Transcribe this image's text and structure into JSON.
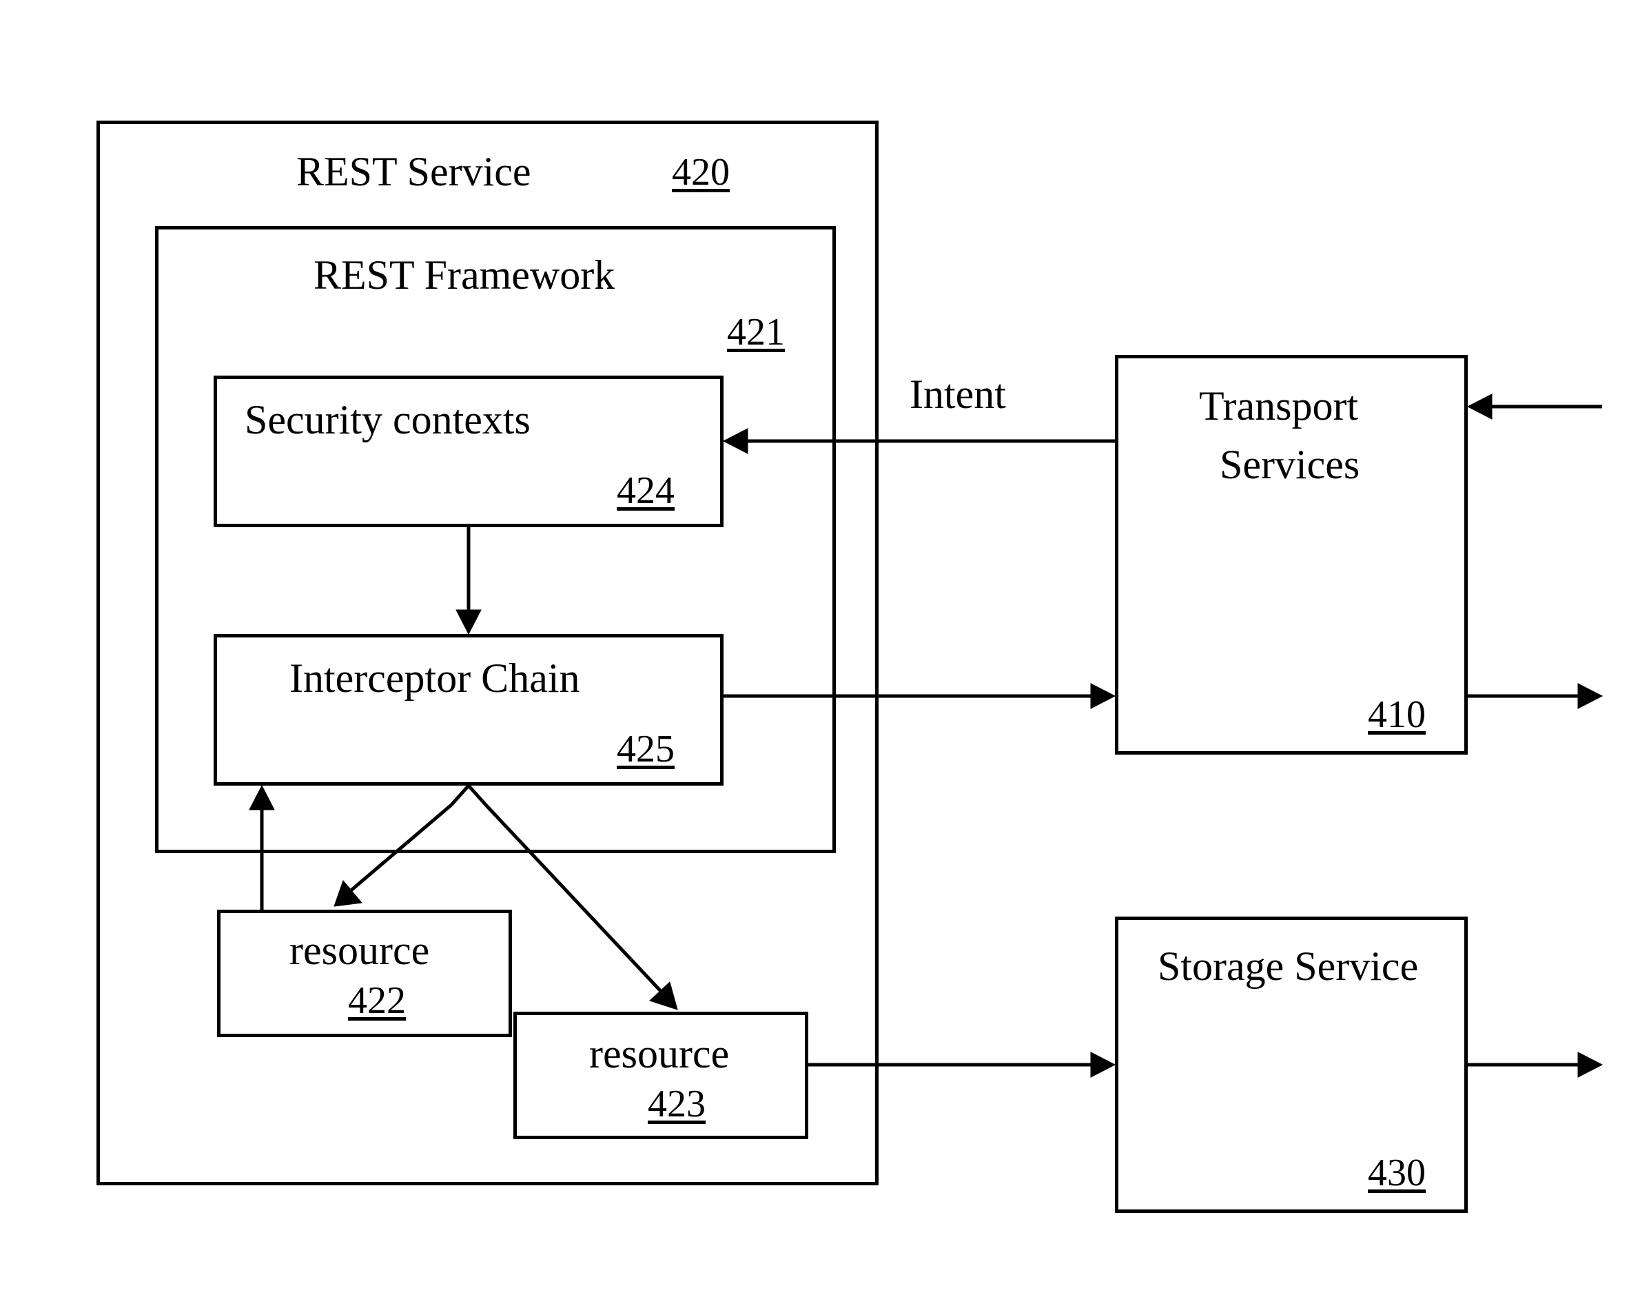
{
  "rest_service": {
    "title": "REST Service",
    "ref": "420"
  },
  "rest_framework": {
    "title": "REST Framework",
    "ref": "421"
  },
  "security_contexts": {
    "title": "Security contexts",
    "ref": "424"
  },
  "interceptor_chain": {
    "title": "Interceptor Chain",
    "ref": "425"
  },
  "resource_a": {
    "title": "resource",
    "ref": "422"
  },
  "resource_b": {
    "title": "resource",
    "ref": "423"
  },
  "transport_services": {
    "title_line1": "Transport",
    "title_line2": "Services",
    "ref": "410"
  },
  "storage_service": {
    "title": "Storage Service",
    "ref": "430"
  },
  "intent_label": "Intent"
}
